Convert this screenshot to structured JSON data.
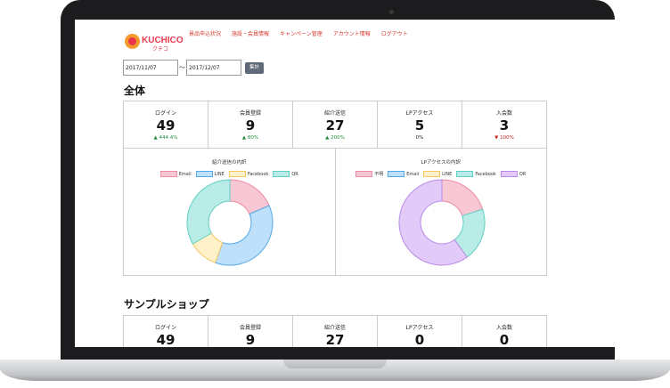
{
  "nav": {
    "logo_text": "KUCHICO",
    "logo_sub": "クチコ",
    "menu": [
      "景品申込状況",
      "施設・会員情報",
      "キャンペーン管理",
      "アカウント情報",
      "ログアウト"
    ]
  },
  "date_range": {
    "from": "2017/11/07",
    "to": "2017/12/07",
    "separator": "〜",
    "button": "集計"
  },
  "sections": [
    {
      "title": "全体",
      "stats": [
        {
          "label": "ログイン",
          "value": "49",
          "change": "▲ 444.4%",
          "trend": "up"
        },
        {
          "label": "会員登録",
          "value": "9",
          "change": "▲ 80%",
          "trend": "up"
        },
        {
          "label": "紹介送信",
          "value": "27",
          "change": "▲ 200%",
          "trend": "up"
        },
        {
          "label": "LPアクセス",
          "value": "5",
          "change": "0%",
          "trend": "flat"
        },
        {
          "label": "入会数",
          "value": "3",
          "change": "▼ 100%",
          "trend": "down"
        }
      ]
    },
    {
      "title": "サンプルショップ",
      "stats": [
        {
          "label": "ログイン",
          "value": "49"
        },
        {
          "label": "会員登録",
          "value": "9"
        },
        {
          "label": "紹介送信",
          "value": "27"
        },
        {
          "label": "LPアクセス",
          "value": "0"
        },
        {
          "label": "入会数",
          "value": "0"
        }
      ]
    }
  ],
  "chart_data": [
    {
      "type": "pie",
      "title": "紹介送信の内訳",
      "categories": [
        "Email",
        "LINE",
        "Facebook",
        "QR"
      ],
      "values": [
        5,
        10,
        3,
        9
      ],
      "colors": [
        "#f7c7d4",
        "#bfe0fa",
        "#fff1c9",
        "#b9ece6"
      ],
      "borders": [
        "#f08aa5",
        "#4fa9ea",
        "#f5c760",
        "#5fcfc3"
      ],
      "legend": "top"
    },
    {
      "type": "pie",
      "title": "LPアクセスの内訳",
      "categories": [
        "不明",
        "Email",
        "LINE",
        "Facebook",
        "QR"
      ],
      "values": [
        1,
        0,
        0,
        1,
        3
      ],
      "colors": [
        "#f7c7d4",
        "#bfe0fa",
        "#fff1c9",
        "#b9ece6",
        "#e2cbf9"
      ],
      "borders": [
        "#f08aa5",
        "#4fa9ea",
        "#f5c760",
        "#5fcfc3",
        "#b98ae8"
      ],
      "legend": "top"
    }
  ]
}
